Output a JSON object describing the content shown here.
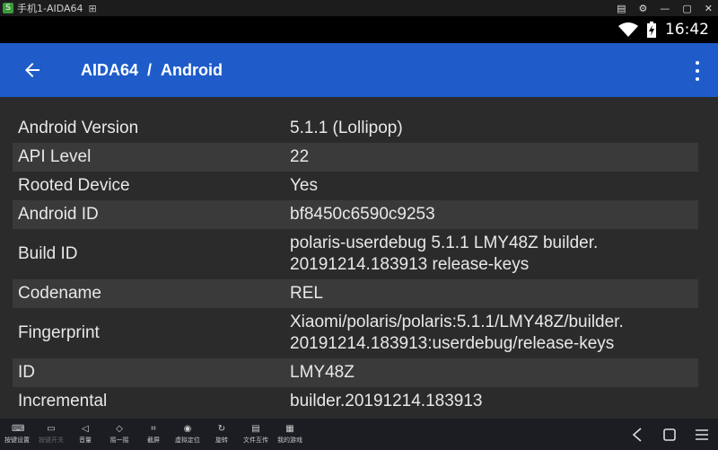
{
  "window": {
    "title": "手机1-AIDA64",
    "controls": [
      "▤",
      "⚙",
      "—",
      "▢",
      "✕"
    ]
  },
  "status_bar": {
    "time": "16:42",
    "icons": [
      "wifi-icon",
      "battery-charging-icon"
    ]
  },
  "app_bar": {
    "app_name": "AIDA64",
    "separator": "/",
    "section": "Android",
    "back_icon": "arrow-left-icon",
    "menu_icon": "overflow-menu-icon"
  },
  "rows": [
    {
      "key": "Android Version",
      "value": "5.1.1 (Lollipop)"
    },
    {
      "key": "API Level",
      "value": "22"
    },
    {
      "key": "Rooted Device",
      "value": "Yes"
    },
    {
      "key": "Android ID",
      "value": "bf8450c6590c9253"
    },
    {
      "key": "Build ID",
      "value": "polaris-userdebug 5.1.1 LMY48Z builder.",
      "value2": "20191214.183913 release-keys"
    },
    {
      "key": "Codename",
      "value": "REL"
    },
    {
      "key": "Fingerprint",
      "value": "Xiaomi/polaris/polaris:5.1.1/LMY48Z/builder.",
      "value2": "20191214.183913:userdebug/release-keys"
    },
    {
      "key": "ID",
      "value": "LMY48Z"
    },
    {
      "key": "Incremental",
      "value": "builder.20191214.183913"
    }
  ],
  "toolbar": {
    "items": [
      {
        "label": "按键设置",
        "icon": "keyboard-icon"
      },
      {
        "label": "按键开关",
        "icon": "toggle-icon"
      },
      {
        "label": "音量",
        "icon": "volume-icon"
      },
      {
        "label": "摇一摇",
        "icon": "shake-icon"
      },
      {
        "label": "截屏",
        "icon": "crop-icon"
      },
      {
        "label": "虚拟定位",
        "icon": "location-icon"
      },
      {
        "label": "旋转",
        "icon": "rotate-icon"
      },
      {
        "label": "文件互传",
        "icon": "folder-icon"
      },
      {
        "label": "我的游戏",
        "icon": "grid-icon"
      }
    ],
    "nav": [
      "back-nav-icon",
      "home-nav-icon",
      "menu-nav-icon"
    ]
  }
}
